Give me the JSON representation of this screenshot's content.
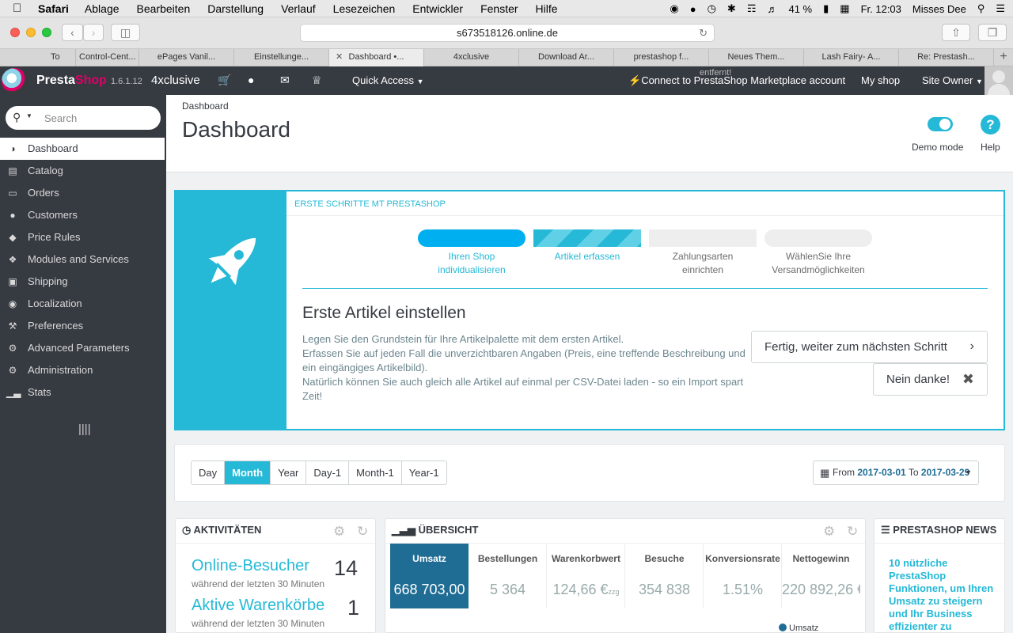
{
  "mac_menu": {
    "app": "Safari",
    "items": [
      "Ablage",
      "Bearbeiten",
      "Darstellung",
      "Verlauf",
      "Lesezeichen",
      "Entwickler",
      "Fenster",
      "Hilfe"
    ],
    "battery": "41 %",
    "clock": "Fr. 12:03",
    "user": "Misses Dee"
  },
  "browser": {
    "url": "s673518126.online.de",
    "tabs": [
      "To",
      "Control-Cent...",
      "ePages Vanil...",
      "Einstellunge...",
      "Dashboard •...",
      "4xclusive",
      "Download Ar...",
      "prestashop f...",
      "Neues Them...",
      "Lash Fairy- A...",
      "Re: Prestash..."
    ],
    "active_tab": 4
  },
  "header": {
    "brand_a": "Presta",
    "brand_b": "Shop",
    "version": "1.6.1.12",
    "shop_name": "4xclusive",
    "quick_access": "Quick Access",
    "connect": "Connect to PrestaShop Marketplace account",
    "my_shop": "My shop",
    "site_owner": "Site Owner"
  },
  "sidebar": {
    "search_placeholder": "Search",
    "items": [
      {
        "label": "Dashboard",
        "icon": "dashboard-icon"
      },
      {
        "label": "Catalog",
        "icon": "book-icon"
      },
      {
        "label": "Orders",
        "icon": "credit-card-icon"
      },
      {
        "label": "Customers",
        "icon": "users-icon"
      },
      {
        "label": "Price Rules",
        "icon": "tags-icon"
      },
      {
        "label": "Modules and Services",
        "icon": "puzzle-icon"
      },
      {
        "label": "Shipping",
        "icon": "truck-icon"
      },
      {
        "label": "Localization",
        "icon": "globe-icon"
      },
      {
        "label": "Preferences",
        "icon": "wrench-icon"
      },
      {
        "label": "Advanced Parameters",
        "icon": "cogs-icon"
      },
      {
        "label": "Administration",
        "icon": "cog-icon"
      },
      {
        "label": "Stats",
        "icon": "bar-chart-icon"
      }
    ]
  },
  "page": {
    "breadcrumb": "Dashboard",
    "title": "Dashboard",
    "demo_mode": "Demo mode",
    "help": "Help"
  },
  "onboarding": {
    "header": "ERSTE SCHRITTE MT PRESTASHOP",
    "steps": [
      "Ihren Shop\nindividualisieren",
      "Artikel erfassen",
      "Zahlungsarten\neinrichten",
      "WählenSie Ihre\nVersandmöglichkeiten"
    ],
    "heading": "Erste Artikel einstellen",
    "text": "Legen Sie den Grundstein für Ihre Artikelpalette mit dem ersten Artikel.\nErfassen Sie auf jeden Fall die unverzichtbaren Angaben (Preis, eine treffende Beschreibung und ein eingängiges Artikelbild).\nNatürlich können Sie auch gleich alle Artikel auf einmal per CSV-Datei laden - so ein Import spart Zeit!",
    "next_button": "Fertig, weiter zum nächsten Schritt",
    "no_button": "Nein danke!",
    "ghost_text": "entfernt!"
  },
  "date_filter": {
    "buttons": [
      "Day",
      "Month",
      "Year",
      "Day-1",
      "Month-1",
      "Year-1"
    ],
    "selected": "Month",
    "from_label": "From",
    "from": "2017-03-01",
    "to_label": "To",
    "to": "2017-03-29"
  },
  "activity": {
    "title": "AKTIVITÄTEN",
    "rows": [
      {
        "label": "Online-Besucher",
        "sub": "während der letzten 30 Minuten",
        "value": "14"
      },
      {
        "label": "Aktive Warenkörbe",
        "sub": "während der letzten 30 Minuten",
        "value": "1"
      }
    ]
  },
  "overview": {
    "title": "ÜBERSICHT",
    "kpis": [
      {
        "label": "Umsatz",
        "value": "668 703,00"
      },
      {
        "label": "Bestellungen",
        "value": "5 364"
      },
      {
        "label": "Warenkorbwert",
        "value": "124,66 €"
      },
      {
        "label": "Besuche",
        "value": "354 838"
      },
      {
        "label": "Konversionsrate",
        "value": "1.51%"
      },
      {
        "label": "Nettogewinn",
        "value": "220 892,26 €"
      }
    ],
    "kpi_suffix": "zzg",
    "legend": "Umsatz"
  },
  "news": {
    "title": "PRESTASHOP NEWS",
    "headline": "10 nützliche PrestaShop Funktionen, um Ihren Umsatz zu steigern und Ihr Business effizienter zu"
  },
  "colors": {
    "accent": "#25b9d7",
    "dark": "#363a41",
    "kpi_selected": "#1f6c94",
    "brand": "#df0067"
  }
}
